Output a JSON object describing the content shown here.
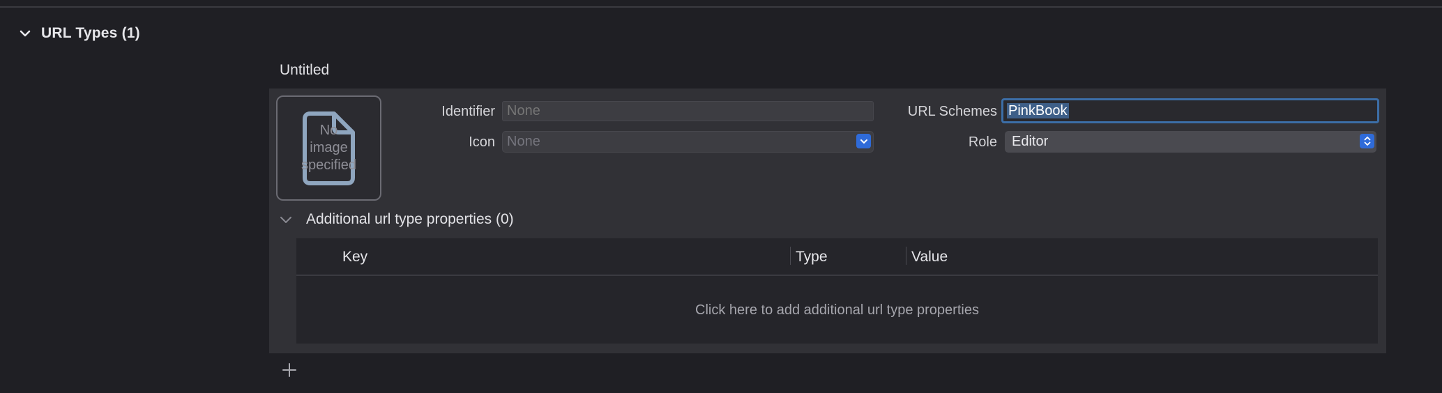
{
  "section": {
    "title": "URL Types (1)"
  },
  "url_type": {
    "title": "Untitled",
    "image_placeholder": "No\nimage\nspecified",
    "identifier": {
      "label": "Identifier",
      "placeholder": "None",
      "value": ""
    },
    "icon": {
      "label": "Icon",
      "selected": "None"
    },
    "url_schemes": {
      "label": "URL Schemes",
      "value": "PinkBook"
    },
    "role": {
      "label": "Role",
      "selected": "Editor"
    }
  },
  "additional": {
    "title": "Additional url type properties (0)",
    "columns": [
      "Key",
      "Type",
      "Value"
    ],
    "empty_text": "Click here to add additional url type properties"
  },
  "colors": {
    "accent": "#2f6bd9",
    "focus_ring": "#3c6ea7",
    "selection": "#3e5f88"
  },
  "icons": {
    "section_toggle": "chevron-down-icon",
    "additional_toggle": "chevron-down-icon",
    "image_placeholder": "document-icon",
    "add": "plus-icon",
    "popup": "up-down-arrows-icon"
  }
}
